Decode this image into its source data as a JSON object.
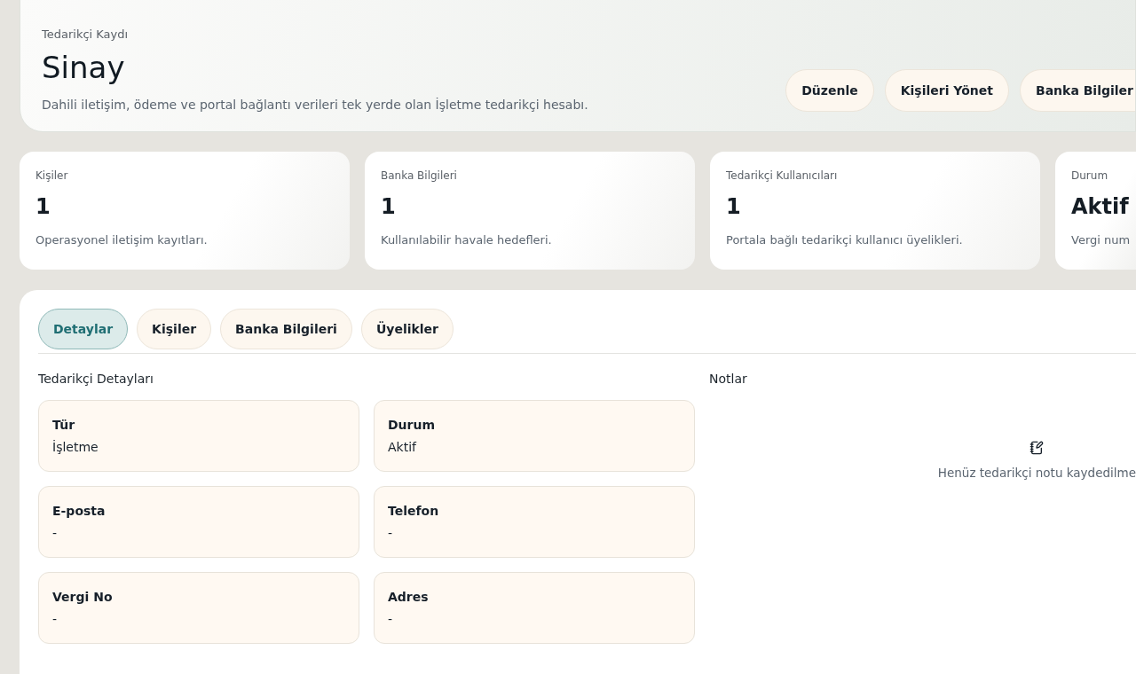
{
  "header": {
    "eyebrow": "Tedarikçi Kaydı",
    "title": "Sinay",
    "description": "Dahili iletişim, ödeme ve portal bağlantı verileri tek yerde olan İşletme tedarikçi hesabı.",
    "buttons": [
      "Düzenle",
      "Kişileri Yönet",
      "Banka Bilgiler"
    ]
  },
  "stats": [
    {
      "label": "Kişiler",
      "value": "1",
      "note": "Operasyonel iletişim kayıtları."
    },
    {
      "label": "Banka Bilgileri",
      "value": "1",
      "note": "Kullanılabilir havale hedefleri."
    },
    {
      "label": "Tedarikçi Kullanıcıları",
      "value": "1",
      "note": "Portala bağlı tedarikçi kullanıcı üyelikleri."
    },
    {
      "label": "Durum",
      "value": "Aktif",
      "note": "Vergi num"
    }
  ],
  "tabs": [
    {
      "label": "Detaylar",
      "selected": true
    },
    {
      "label": "Kişiler",
      "selected": false
    },
    {
      "label": "Banka Bilgileri",
      "selected": false
    },
    {
      "label": "Üyelikler",
      "selected": false
    }
  ],
  "details": {
    "title": "Tedarikçi Detayları",
    "fields": [
      {
        "label": "Tür",
        "value": "İşletme"
      },
      {
        "label": "Durum",
        "value": "Aktif"
      },
      {
        "label": "E-posta",
        "value": "-"
      },
      {
        "label": "Telefon",
        "value": "-"
      },
      {
        "label": "Vergi No",
        "value": "-"
      },
      {
        "label": "Adres",
        "value": "-"
      }
    ]
  },
  "notes": {
    "title": "Notlar",
    "empty_text": "Henüz tedarikçi notu kaydedilme"
  }
}
